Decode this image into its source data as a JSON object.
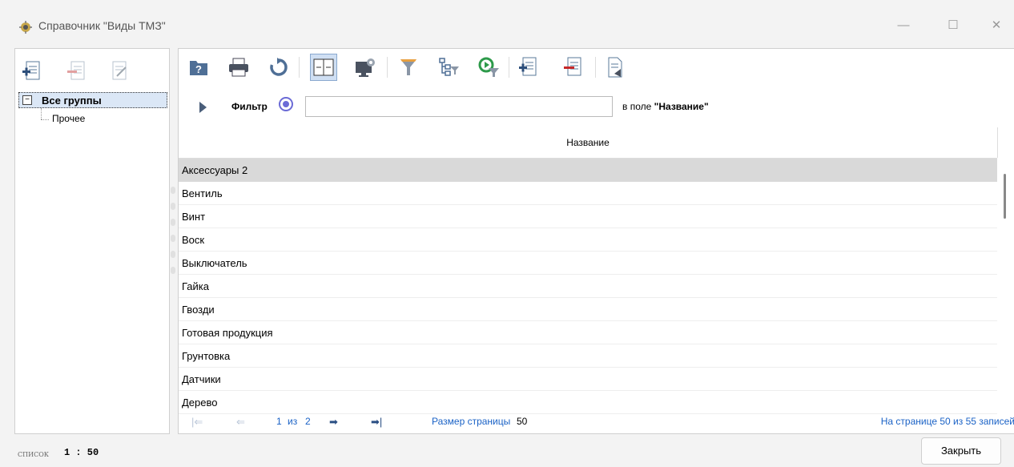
{
  "window": {
    "title": "Справочник \"Виды ТМЗ\"",
    "minimize": "—",
    "maximize": "☐",
    "close": "✕"
  },
  "tree": {
    "toolbar": [
      "add-group-icon",
      "edit-group-icon",
      "delete-group-icon"
    ],
    "root": {
      "toggle": "−",
      "label": "Все группы"
    },
    "children": [
      "Прочее"
    ]
  },
  "toolbar": {
    "icons": [
      "help-icon",
      "print-icon",
      "refresh-icon",
      "fit-columns-icon",
      "display-settings-icon",
      "filter-icon",
      "hierarchy-filter-icon",
      "apply-filter-icon",
      "add-record-icon",
      "delete-record-icon",
      "export-icon"
    ]
  },
  "filter": {
    "label": "Фильтр",
    "value": "",
    "suffix_prefix": "в поле ",
    "suffix_field": "\"Название\""
  },
  "table": {
    "header": "Название",
    "rows": [
      "Аксессуары 2",
      "Вентиль",
      "Винт",
      "Воск",
      "Выключатель",
      "Гайка",
      "Гвозди",
      "Готовая продукция",
      "Грунтовка",
      "Датчики",
      "Дерево"
    ],
    "selected_index": 0
  },
  "pager": {
    "first": "|⇐",
    "prev": "⇐",
    "current": "1",
    "of": "из",
    "total": "2",
    "next": "➡",
    "last": "➡|",
    "size_label": "Размер страницы",
    "size_value": "50",
    "summary": "На странице 50 из 55 записей"
  },
  "status": {
    "label": "список",
    "value": "1 : 50"
  },
  "close_button": "Закрыть",
  "colors": {
    "selected_row": "#d9d9d9",
    "tree_selected": "#dbe7f6",
    "link_blue": "#1a62c6",
    "radio": "#6b6bd6"
  }
}
